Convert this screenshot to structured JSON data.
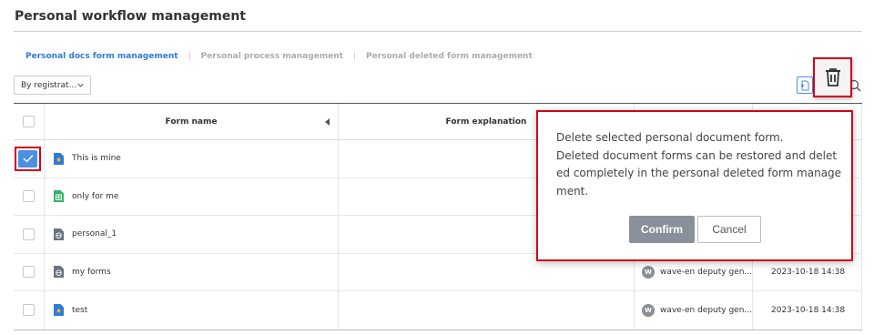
{
  "page": {
    "title": "Personal workflow management"
  },
  "tabs": [
    {
      "label": "Personal docs form management",
      "active": true
    },
    {
      "label": "Personal process management",
      "active": false
    },
    {
      "label": "Personal deleted form management",
      "active": false
    }
  ],
  "sort_select": {
    "value": "By registrat..."
  },
  "table": {
    "headers": {
      "form_name": "Form name",
      "form_explanation": "Form explanation"
    },
    "rows": [
      {
        "name": "This is mine",
        "icon": "doc-star-icon",
        "checked": true,
        "author": "",
        "date": ""
      },
      {
        "name": "only for me",
        "icon": "sheet-icon",
        "checked": false,
        "author": "",
        "date": ""
      },
      {
        "name": "personal_1",
        "icon": "web-doc-icon",
        "checked": false,
        "author": "",
        "date": ""
      },
      {
        "name": "my forms",
        "icon": "web-doc-icon",
        "checked": false,
        "author": "wave-en deputy gen...",
        "date": "2023-10-18 14:38",
        "avatar": "W"
      },
      {
        "name": "test",
        "icon": "doc-star-icon",
        "checked": false,
        "author": "wave-en deputy gen...",
        "date": "2023-10-18 14:38",
        "avatar": "W"
      }
    ]
  },
  "dialog": {
    "lines": [
      "Delete selected personal document form.",
      "Deleted document forms can be restored and delet",
      "ed completely in the personal deleted form manage",
      "ment."
    ],
    "confirm_label": "Confirm",
    "cancel_label": "Cancel"
  },
  "colors": {
    "accent": "#2e7bd8",
    "highlight": "#d0021b",
    "checkbox": "#4a90e2"
  }
}
